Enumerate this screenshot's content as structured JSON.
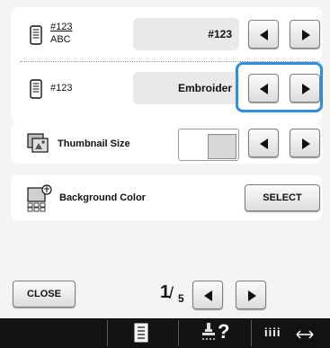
{
  "rows": {
    "pattern_name": {
      "icon": "pattern-name-display-icon",
      "label_top": "#123",
      "label_bottom": "ABC",
      "value": "#123"
    },
    "frame_display": {
      "icon": "frame-display-icon",
      "label": "#123",
      "value": "Embroider"
    },
    "thumbnail": {
      "icon": "thumbnail-size-icon",
      "label": "Thumbnail Size"
    },
    "background": {
      "icon": "background-color-icon",
      "label": "Background Color",
      "button": "SELECT"
    }
  },
  "footer": {
    "close": "CLOSE",
    "page_current": "1",
    "page_total": "5"
  },
  "bottom_bar": {
    "icons": [
      "document-list-icon",
      "help-icon",
      "spacing-arrow-icon"
    ],
    "help_text": "?",
    "spacing_text": "iiii"
  },
  "colors": {
    "highlight": "#2f8ee0",
    "bar": "#131313"
  }
}
